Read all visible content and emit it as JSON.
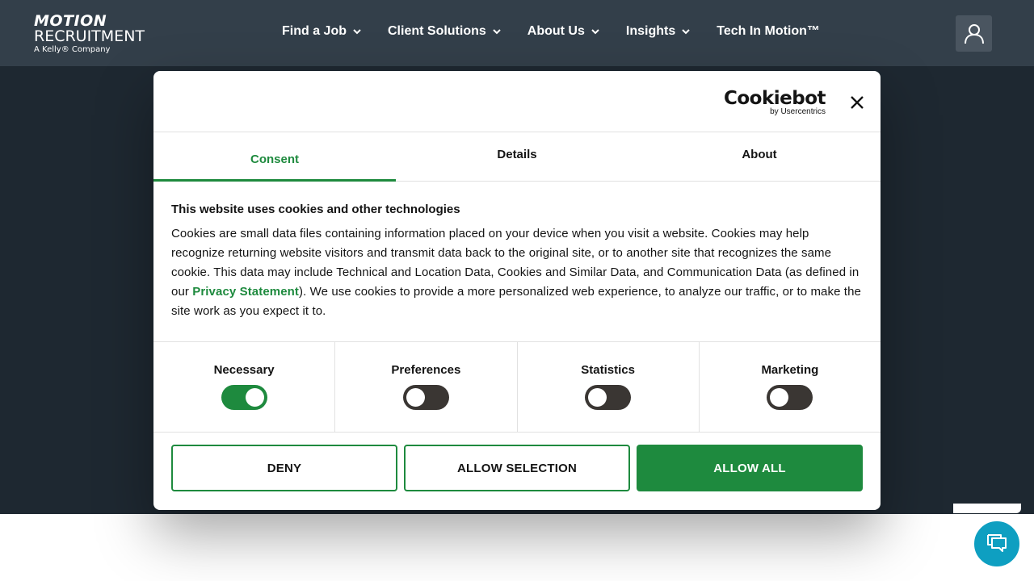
{
  "header": {
    "logo": {
      "line1": "MOTION",
      "line2": "RECRUITMENT",
      "line3": "A Kelly® Company"
    },
    "nav": [
      {
        "label": "Find a Job",
        "has_dropdown": true
      },
      {
        "label": "Client Solutions",
        "has_dropdown": true
      },
      {
        "label": "About Us",
        "has_dropdown": true
      },
      {
        "label": "Insights",
        "has_dropdown": true
      },
      {
        "label": "Tech In Motion™",
        "has_dropdown": false
      }
    ],
    "user_icon": "user-icon"
  },
  "dialog": {
    "brand": {
      "name": "Cookiebot",
      "sub": "by Usercentrics"
    },
    "close_icon": "close-icon",
    "tabs": [
      {
        "label": "Consent",
        "active": true
      },
      {
        "label": "Details",
        "active": false
      },
      {
        "label": "About",
        "active": false
      }
    ],
    "title": "This website uses cookies and other technologies",
    "text_before_link": "Cookies are small data files containing information placed on your device when you visit a website. Cookies may help recognize returning website visitors and transmit data back to the original site, or to another site that recognizes the same cookie. This data may include Technical and Location Data, Cookies and Similar Data, and Communication Data (as defined in our ",
    "link_text": "Privacy Statement",
    "text_after_link": "). We use cookies to provide a more personalized web experience, to analyze our traffic, or to make the site work as you expect it to.",
    "toggles": [
      {
        "label": "Necessary",
        "on": true
      },
      {
        "label": "Preferences",
        "on": false
      },
      {
        "label": "Statistics",
        "on": false
      },
      {
        "label": "Marketing",
        "on": false
      }
    ],
    "buttons": {
      "deny": "DENY",
      "allow_selection": "ALLOW SELECTION",
      "allow_all": "ALLOW ALL"
    }
  },
  "chat_icon": "chat-icon",
  "colors": {
    "header_bg": "#333f4a",
    "backdrop": "#1e2831",
    "accent_green": "#1e8a3e",
    "chat_blue": "#0e9fc1"
  }
}
